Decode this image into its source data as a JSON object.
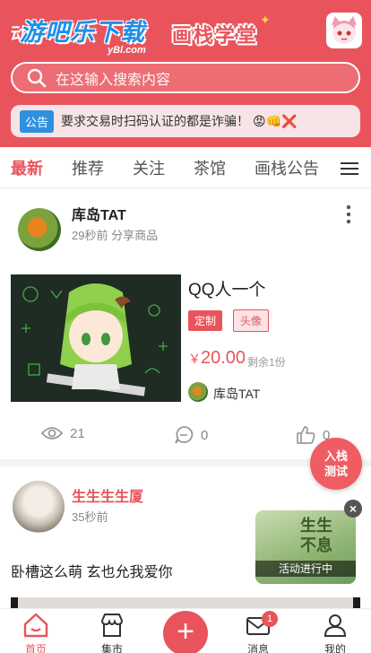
{
  "header": {
    "left_text": "动",
    "watermark_main": "游吧乐下载",
    "watermark_sub": "yBl.com",
    "logo_text": "画栈学堂",
    "avatar_icon": "anime-avatar-icon"
  },
  "search": {
    "placeholder": "在这输入搜索内容",
    "icon": "search-icon"
  },
  "notice": {
    "badge": "公告",
    "text": "要求交易时扫码认证的都是诈骗！",
    "emoji": "😡👊❌"
  },
  "tabs": [
    {
      "label": "最新",
      "active": true
    },
    {
      "label": "推荐"
    },
    {
      "label": "关注"
    },
    {
      "label": "茶馆"
    },
    {
      "label": "画栈公告"
    }
  ],
  "post1": {
    "user": "库岛TAT",
    "meta": "29秒前 分享商品",
    "item_title": "QQ人一个",
    "tag_custom": "定制",
    "tag_avatar": "头像",
    "price_symbol": "￥",
    "price": "20.00",
    "stock": "剩余1份",
    "seller": "库岛TAT",
    "views": "21",
    "comments": "0",
    "likes": "0"
  },
  "post2": {
    "user": "生生生生厦",
    "meta": "35秒前",
    "text": "卧槽这么萌 玄也允我爱你"
  },
  "float_button": {
    "line1": "入栈",
    "line2": "测试"
  },
  "promo": {
    "art_text_1": "生生",
    "art_text_2": "不息",
    "bar_text": "活动进行中"
  },
  "bottom_nav": {
    "home": "首页",
    "market": "集市",
    "messages": "消息",
    "messages_badge": "1",
    "mine": "我的"
  },
  "colors": {
    "primary": "#e9545c",
    "badge_blue": "#2f8fe0"
  }
}
